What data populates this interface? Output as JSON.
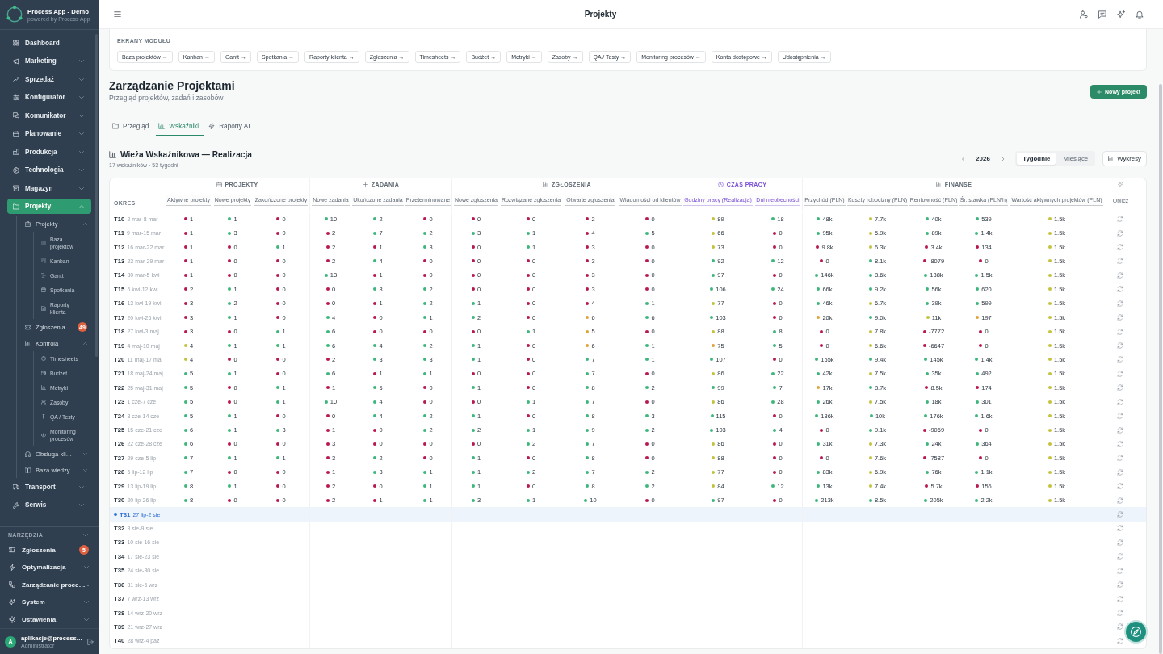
{
  "sidebar": {
    "app_name": "Process App - Demo",
    "app_tagline": "powered by Process App",
    "items": [
      {
        "label": "Dashboard",
        "selected": false
      },
      {
        "label": "Marketing",
        "selected": false,
        "expanded": false
      },
      {
        "label": "Sprzedaż",
        "selected": false,
        "expanded": false
      },
      {
        "label": "Konfigurator",
        "selected": false,
        "expanded": false
      },
      {
        "label": "Komunikator",
        "selected": false,
        "expanded": false
      },
      {
        "label": "Planowanie",
        "selected": false,
        "expanded": false
      },
      {
        "label": "Produkcja",
        "selected": false,
        "expanded": false
      },
      {
        "label": "Technologia",
        "selected": false,
        "expanded": false
      },
      {
        "label": "Magazyn",
        "selected": false,
        "expanded": false
      },
      {
        "label": "Projekty",
        "selected": true,
        "expanded": true,
        "children": [
          {
            "label": "Projekty",
            "selected": false,
            "expanded": true,
            "children": [
              {
                "label": "Baza projektów",
                "selected": false
              },
              {
                "label": "Kanban",
                "selected": false
              },
              {
                "label": "Gantt",
                "selected": false
              },
              {
                "label": "Spotkania",
                "selected": false
              },
              {
                "label": "Raporty klienta",
                "selected": false
              }
            ]
          },
          {
            "label": "Zgłoszenia",
            "selected": false,
            "badge": "49"
          },
          {
            "label": "Kontrola",
            "selected": false,
            "expanded": true,
            "children": [
              {
                "label": "Timesheets",
                "selected": false
              },
              {
                "label": "Budżet",
                "selected": false
              },
              {
                "label": "Metryki",
                "selected": false
              },
              {
                "label": "Zasoby",
                "selected": false
              },
              {
                "label": "QA / Testy",
                "selected": false
              },
              {
                "label": "Monitoring procesów",
                "selected": false
              }
            ]
          },
          {
            "label": "Obsługa kli…",
            "selected": false,
            "expanded": false
          },
          {
            "label": "Baza wiedzy",
            "selected": false,
            "expanded": false
          }
        ]
      },
      {
        "label": "Transport",
        "selected": false,
        "expanded": false
      },
      {
        "label": "Serwis",
        "selected": false,
        "expanded": false
      }
    ],
    "tools": {
      "title": "NARZĘDZIA",
      "items": [
        {
          "label": "Zgłoszenia",
          "selected": false,
          "badge": "5"
        },
        {
          "label": "Optymalizacja",
          "selected": false,
          "expanded": false
        },
        {
          "label": "Zarządzanie proce…",
          "selected": false,
          "expanded": false
        },
        {
          "label": "System",
          "selected": false,
          "expanded": false
        },
        {
          "label": "Ustawienia",
          "selected": false,
          "expanded": false
        }
      ]
    },
    "user": {
      "initial": "A",
      "name": "aplikacje@process…",
      "role": "Administrator"
    }
  },
  "topbar": {
    "title": "Projekty"
  },
  "module_screens": {
    "title": "EKRANY MODUŁU",
    "links": [
      "Baza projektów →",
      "Kanban →",
      "Gantt →",
      "Spotkania →",
      "Raporty klienta →",
      "Zgłoszenia →",
      "Timesheets →",
      "Budżet →",
      "Metryki →",
      "Zasoby →",
      "QA / Testy →",
      "Monitoring procesów →",
      "Konta dostępowe →",
      "Udostępnienia →"
    ]
  },
  "page": {
    "title": "Zarządzanie Projektami",
    "subtitle": "Przegląd projektów, zadań i zasobów",
    "new_button": "Nowy projekt"
  },
  "tabs": [
    {
      "label": "Przegląd",
      "selected": false
    },
    {
      "label": "Wskaźniki",
      "selected": true
    },
    {
      "label": "Raporty AI",
      "selected": false
    }
  ],
  "indicator_tower": {
    "title": "Wieża Wskaźnikowa — Realizacja",
    "subtitle": "17 wskaźników · 53 tygodni",
    "year": "2026",
    "view_modes": [
      {
        "label": "Tygodnie",
        "selected": true
      },
      {
        "label": "Miesiące",
        "selected": false
      }
    ],
    "charts_button": "Wykresy"
  },
  "table": {
    "period_header": "OKRES",
    "action_header": "Oblicz",
    "groups": [
      {
        "label": "PROJEKTY",
        "color": "#5f6973",
        "columns": [
          "Aktywne projekty",
          "Nowe projekty",
          "Zakończone projekty"
        ]
      },
      {
        "label": "ZADANIA",
        "color": "#5f6973",
        "columns": [
          "Nowe zadania",
          "Ukończone zadania",
          "Przeterminowane"
        ]
      },
      {
        "label": "ZGŁOSZENIA",
        "color": "#5f6973",
        "columns": [
          "Nowe zgłoszenia",
          "Rozwiązane zgłoszenia",
          "Otwarte zgłoszenia",
          "Wiadomości od klientów"
        ]
      },
      {
        "label": "CZAS PRACY",
        "color": "#7b4fd6",
        "columns": [
          "Godziny pracy (Realizacja)",
          "Dni nieobecności"
        ]
      },
      {
        "label": "FINANSE",
        "color": "#5f6973",
        "columns": [
          "Przychód (PLN)",
          "Koszty robocizny (PLN)",
          "Rentowność (PLN)",
          "Śr. stawka (PLN/h)",
          "Wartość aktywnych projektów (PLN)"
        ]
      }
    ],
    "rows": [
      {
        "period": "T10",
        "dates": "2 mar-8 mar",
        "current": false,
        "cells": [
          {
            "value": "1",
            "color": "#b8184e"
          },
          {
            "value": "1",
            "color": "#3bb77b"
          },
          {
            "value": "0",
            "color": "#b8184e"
          },
          {
            "value": "10",
            "color": "#3bb77b"
          },
          {
            "value": "2",
            "color": "#3bb77b"
          },
          {
            "value": "0",
            "color": "#b8184e"
          },
          {
            "value": "0",
            "color": "#b8184e"
          },
          {
            "value": "0",
            "color": "#b8184e"
          },
          {
            "value": "2",
            "color": "#b8184e"
          },
          {
            "value": "0",
            "color": "#b8184e"
          },
          {
            "value": "89",
            "color": "#c4c23b"
          },
          {
            "value": "18",
            "color": "#3bb77b"
          },
          {
            "value": "48k",
            "color": "#3bb77b"
          },
          {
            "value": "7.7k",
            "color": "#c4c23b"
          },
          {
            "value": "40k",
            "color": "#3bb77b"
          },
          {
            "value": "539",
            "color": "#3bb77b"
          },
          {
            "value": "1.5k",
            "color": "#c4c23b"
          }
        ]
      },
      {
        "period": "T11",
        "dates": "9 mar-15 mar",
        "current": false,
        "cells": [
          {
            "value": "1",
            "color": "#b8184e"
          },
          {
            "value": "3",
            "color": "#3bb77b"
          },
          {
            "value": "0",
            "color": "#b8184e"
          },
          {
            "value": "2",
            "color": "#b8184e"
          },
          {
            "value": "7",
            "color": "#3bb77b"
          },
          {
            "value": "2",
            "color": "#3bb77b"
          },
          {
            "value": "3",
            "color": "#3bb77b"
          },
          {
            "value": "1",
            "color": "#3bb77b"
          },
          {
            "value": "4",
            "color": "#b8184e"
          },
          {
            "value": "5",
            "color": "#3bb77b"
          },
          {
            "value": "66",
            "color": "#c4c23b"
          },
          {
            "value": "0",
            "color": "#b8184e"
          },
          {
            "value": "95k",
            "color": "#3bb77b"
          },
          {
            "value": "5.9k",
            "color": "#c4c23b"
          },
          {
            "value": "89k",
            "color": "#3bb77b"
          },
          {
            "value": "1.4k",
            "color": "#3bb77b"
          },
          {
            "value": "1.5k",
            "color": "#c4c23b"
          }
        ]
      },
      {
        "period": "T12",
        "dates": "16 mar-22 mar",
        "current": false,
        "cells": [
          {
            "value": "1",
            "color": "#b8184e"
          },
          {
            "value": "0",
            "color": "#b8184e"
          },
          {
            "value": "1",
            "color": "#3bb77b"
          },
          {
            "value": "2",
            "color": "#b8184e"
          },
          {
            "value": "1",
            "color": "#b8184e"
          },
          {
            "value": "3",
            "color": "#3bb77b"
          },
          {
            "value": "0",
            "color": "#b8184e"
          },
          {
            "value": "1",
            "color": "#3bb77b"
          },
          {
            "value": "3",
            "color": "#b8184e"
          },
          {
            "value": "0",
            "color": "#b8184e"
          },
          {
            "value": "73",
            "color": "#c4c23b"
          },
          {
            "value": "0",
            "color": "#b8184e"
          },
          {
            "value": "9.8k",
            "color": "#b8184e"
          },
          {
            "value": "6.3k",
            "color": "#c4c23b"
          },
          {
            "value": "3.4k",
            "color": "#b8184e"
          },
          {
            "value": "134",
            "color": "#b8184e"
          },
          {
            "value": "1.5k",
            "color": "#c4c23b"
          }
        ]
      },
      {
        "period": "T13",
        "dates": "23 mar-29 mar",
        "current": false,
        "cells": [
          {
            "value": "1",
            "color": "#b8184e"
          },
          {
            "value": "0",
            "color": "#b8184e"
          },
          {
            "value": "0",
            "color": "#b8184e"
          },
          {
            "value": "2",
            "color": "#b8184e"
          },
          {
            "value": "4",
            "color": "#3bb77b"
          },
          {
            "value": "0",
            "color": "#b8184e"
          },
          {
            "value": "0",
            "color": "#b8184e"
          },
          {
            "value": "0",
            "color": "#b8184e"
          },
          {
            "value": "3",
            "color": "#b8184e"
          },
          {
            "value": "0",
            "color": "#b8184e"
          },
          {
            "value": "92",
            "color": "#3bb77b"
          },
          {
            "value": "12",
            "color": "#3bb77b"
          },
          {
            "value": "0",
            "color": "#b8184e"
          },
          {
            "value": "8.1k",
            "color": "#3bb77b"
          },
          {
            "value": "-8079",
            "color": "#b8184e"
          },
          {
            "value": "0",
            "color": "#b8184e"
          },
          {
            "value": "1.5k",
            "color": "#c4c23b"
          }
        ]
      },
      {
        "period": "T14",
        "dates": "30 mar-5 kwi",
        "current": false,
        "cells": [
          {
            "value": "1",
            "color": "#b8184e"
          },
          {
            "value": "0",
            "color": "#b8184e"
          },
          {
            "value": "0",
            "color": "#b8184e"
          },
          {
            "value": "13",
            "color": "#3bb77b"
          },
          {
            "value": "1",
            "color": "#b8184e"
          },
          {
            "value": "0",
            "color": "#b8184e"
          },
          {
            "value": "0",
            "color": "#b8184e"
          },
          {
            "value": "0",
            "color": "#b8184e"
          },
          {
            "value": "3",
            "color": "#b8184e"
          },
          {
            "value": "0",
            "color": "#b8184e"
          },
          {
            "value": "97",
            "color": "#3bb77b"
          },
          {
            "value": "0",
            "color": "#b8184e"
          },
          {
            "value": "146k",
            "color": "#3bb77b"
          },
          {
            "value": "8.6k",
            "color": "#3bb77b"
          },
          {
            "value": "138k",
            "color": "#3bb77b"
          },
          {
            "value": "1.5k",
            "color": "#3bb77b"
          },
          {
            "value": "1.5k",
            "color": "#c4c23b"
          }
        ]
      },
      {
        "period": "T15",
        "dates": "6 kwi-12 kwi",
        "current": false,
        "cells": [
          {
            "value": "2",
            "color": "#b8184e"
          },
          {
            "value": "1",
            "color": "#3bb77b"
          },
          {
            "value": "0",
            "color": "#b8184e"
          },
          {
            "value": "0",
            "color": "#b8184e"
          },
          {
            "value": "8",
            "color": "#3bb77b"
          },
          {
            "value": "2",
            "color": "#3bb77b"
          },
          {
            "value": "0",
            "color": "#b8184e"
          },
          {
            "value": "0",
            "color": "#b8184e"
          },
          {
            "value": "3",
            "color": "#b8184e"
          },
          {
            "value": "0",
            "color": "#b8184e"
          },
          {
            "value": "106",
            "color": "#3bb77b"
          },
          {
            "value": "24",
            "color": "#3bb77b"
          },
          {
            "value": "66k",
            "color": "#3bb77b"
          },
          {
            "value": "9.2k",
            "color": "#3bb77b"
          },
          {
            "value": "56k",
            "color": "#3bb77b"
          },
          {
            "value": "620",
            "color": "#3bb77b"
          },
          {
            "value": "1.5k",
            "color": "#c4c23b"
          }
        ]
      },
      {
        "period": "T16",
        "dates": "13 kwi-19 kwi",
        "current": false,
        "cells": [
          {
            "value": "3",
            "color": "#b8184e"
          },
          {
            "value": "2",
            "color": "#3bb77b"
          },
          {
            "value": "0",
            "color": "#b8184e"
          },
          {
            "value": "0",
            "color": "#b8184e"
          },
          {
            "value": "1",
            "color": "#b8184e"
          },
          {
            "value": "2",
            "color": "#3bb77b"
          },
          {
            "value": "1",
            "color": "#3bb77b"
          },
          {
            "value": "0",
            "color": "#b8184e"
          },
          {
            "value": "4",
            "color": "#b8184e"
          },
          {
            "value": "1",
            "color": "#3bb77b"
          },
          {
            "value": "77",
            "color": "#c4c23b"
          },
          {
            "value": "0",
            "color": "#b8184e"
          },
          {
            "value": "46k",
            "color": "#3bb77b"
          },
          {
            "value": "6.7k",
            "color": "#c4c23b"
          },
          {
            "value": "39k",
            "color": "#3bb77b"
          },
          {
            "value": "599",
            "color": "#3bb77b"
          },
          {
            "value": "1.5k",
            "color": "#c4c23b"
          }
        ]
      },
      {
        "period": "T17",
        "dates": "20 kwi-26 kwi",
        "current": false,
        "cells": [
          {
            "value": "3",
            "color": "#b8184e"
          },
          {
            "value": "1",
            "color": "#3bb77b"
          },
          {
            "value": "0",
            "color": "#b8184e"
          },
          {
            "value": "4",
            "color": "#3bb77b"
          },
          {
            "value": "0",
            "color": "#b8184e"
          },
          {
            "value": "1",
            "color": "#3bb77b"
          },
          {
            "value": "2",
            "color": "#3bb77b"
          },
          {
            "value": "0",
            "color": "#b8184e"
          },
          {
            "value": "6",
            "color": "#e2a23b"
          },
          {
            "value": "6",
            "color": "#3bb77b"
          },
          {
            "value": "103",
            "color": "#3bb77b"
          },
          {
            "value": "0",
            "color": "#b8184e"
          },
          {
            "value": "20k",
            "color": "#e2a23b"
          },
          {
            "value": "9.0k",
            "color": "#3bb77b"
          },
          {
            "value": "11k",
            "color": "#c4c23b"
          },
          {
            "value": "197",
            "color": "#e2a23b"
          },
          {
            "value": "1.5k",
            "color": "#c4c23b"
          }
        ]
      },
      {
        "period": "T18",
        "dates": "27 kwi-3 maj",
        "current": false,
        "cells": [
          {
            "value": "3",
            "color": "#b8184e"
          },
          {
            "value": "0",
            "color": "#b8184e"
          },
          {
            "value": "1",
            "color": "#3bb77b"
          },
          {
            "value": "6",
            "color": "#3bb77b"
          },
          {
            "value": "0",
            "color": "#b8184e"
          },
          {
            "value": "0",
            "color": "#b8184e"
          },
          {
            "value": "0",
            "color": "#b8184e"
          },
          {
            "value": "1",
            "color": "#3bb77b"
          },
          {
            "value": "5",
            "color": "#e2a23b"
          },
          {
            "value": "0",
            "color": "#b8184e"
          },
          {
            "value": "88",
            "color": "#c4c23b"
          },
          {
            "value": "8",
            "color": "#3bb77b"
          },
          {
            "value": "0",
            "color": "#b8184e"
          },
          {
            "value": "7.8k",
            "color": "#c4c23b"
          },
          {
            "value": "-7772",
            "color": "#b8184e"
          },
          {
            "value": "0",
            "color": "#b8184e"
          },
          {
            "value": "1.5k",
            "color": "#c4c23b"
          }
        ]
      },
      {
        "period": "T19",
        "dates": "4 maj-10 maj",
        "current": false,
        "cells": [
          {
            "value": "4",
            "color": "#c4c23b"
          },
          {
            "value": "1",
            "color": "#3bb77b"
          },
          {
            "value": "1",
            "color": "#3bb77b"
          },
          {
            "value": "6",
            "color": "#3bb77b"
          },
          {
            "value": "4",
            "color": "#3bb77b"
          },
          {
            "value": "2",
            "color": "#3bb77b"
          },
          {
            "value": "1",
            "color": "#3bb77b"
          },
          {
            "value": "0",
            "color": "#b8184e"
          },
          {
            "value": "6",
            "color": "#e2a23b"
          },
          {
            "value": "1",
            "color": "#3bb77b"
          },
          {
            "value": "75",
            "color": "#e2a23b"
          },
          {
            "value": "5",
            "color": "#3bb77b"
          },
          {
            "value": "0",
            "color": "#b8184e"
          },
          {
            "value": "6.6k",
            "color": "#c4c23b"
          },
          {
            "value": "-6647",
            "color": "#b8184e"
          },
          {
            "value": "0",
            "color": "#b8184e"
          },
          {
            "value": "1.5k",
            "color": "#c4c23b"
          }
        ]
      },
      {
        "period": "T20",
        "dates": "11 maj-17 maj",
        "current": false,
        "cells": [
          {
            "value": "4",
            "color": "#c4c23b"
          },
          {
            "value": "0",
            "color": "#b8184e"
          },
          {
            "value": "0",
            "color": "#b8184e"
          },
          {
            "value": "2",
            "color": "#b8184e"
          },
          {
            "value": "3",
            "color": "#3bb77b"
          },
          {
            "value": "3",
            "color": "#3bb77b"
          },
          {
            "value": "1",
            "color": "#3bb77b"
          },
          {
            "value": "0",
            "color": "#b8184e"
          },
          {
            "value": "7",
            "color": "#3bb77b"
          },
          {
            "value": "1",
            "color": "#3bb77b"
          },
          {
            "value": "107",
            "color": "#3bb77b"
          },
          {
            "value": "0",
            "color": "#b8184e"
          },
          {
            "value": "155k",
            "color": "#3bb77b"
          },
          {
            "value": "9.4k",
            "color": "#3bb77b"
          },
          {
            "value": "145k",
            "color": "#3bb77b"
          },
          {
            "value": "1.4k",
            "color": "#3bb77b"
          },
          {
            "value": "1.5k",
            "color": "#c4c23b"
          }
        ]
      },
      {
        "period": "T21",
        "dates": "18 maj-24 maj",
        "current": false,
        "cells": [
          {
            "value": "5",
            "color": "#3bb77b"
          },
          {
            "value": "1",
            "color": "#3bb77b"
          },
          {
            "value": "0",
            "color": "#b8184e"
          },
          {
            "value": "6",
            "color": "#3bb77b"
          },
          {
            "value": "1",
            "color": "#b8184e"
          },
          {
            "value": "1",
            "color": "#3bb77b"
          },
          {
            "value": "0",
            "color": "#b8184e"
          },
          {
            "value": "0",
            "color": "#b8184e"
          },
          {
            "value": "7",
            "color": "#3bb77b"
          },
          {
            "value": "0",
            "color": "#b8184e"
          },
          {
            "value": "86",
            "color": "#c4c23b"
          },
          {
            "value": "22",
            "color": "#3bb77b"
          },
          {
            "value": "42k",
            "color": "#3bb77b"
          },
          {
            "value": "7.5k",
            "color": "#c4c23b"
          },
          {
            "value": "35k",
            "color": "#3bb77b"
          },
          {
            "value": "492",
            "color": "#3bb77b"
          },
          {
            "value": "1.5k",
            "color": "#c4c23b"
          }
        ]
      },
      {
        "period": "T22",
        "dates": "25 maj-31 maj",
        "current": false,
        "cells": [
          {
            "value": "5",
            "color": "#3bb77b"
          },
          {
            "value": "0",
            "color": "#b8184e"
          },
          {
            "value": "1",
            "color": "#3bb77b"
          },
          {
            "value": "1",
            "color": "#b8184e"
          },
          {
            "value": "5",
            "color": "#3bb77b"
          },
          {
            "value": "0",
            "color": "#b8184e"
          },
          {
            "value": "1",
            "color": "#3bb77b"
          },
          {
            "value": "0",
            "color": "#b8184e"
          },
          {
            "value": "8",
            "color": "#3bb77b"
          },
          {
            "value": "2",
            "color": "#3bb77b"
          },
          {
            "value": "99",
            "color": "#3bb77b"
          },
          {
            "value": "7",
            "color": "#3bb77b"
          },
          {
            "value": "17k",
            "color": "#e2a23b"
          },
          {
            "value": "8.7k",
            "color": "#3bb77b"
          },
          {
            "value": "8.5k",
            "color": "#b8184e"
          },
          {
            "value": "174",
            "color": "#b8184e"
          },
          {
            "value": "1.5k",
            "color": "#c4c23b"
          }
        ]
      },
      {
        "period": "T23",
        "dates": "1 cze-7 cze",
        "current": false,
        "cells": [
          {
            "value": "5",
            "color": "#3bb77b"
          },
          {
            "value": "0",
            "color": "#b8184e"
          },
          {
            "value": "1",
            "color": "#3bb77b"
          },
          {
            "value": "10",
            "color": "#3bb77b"
          },
          {
            "value": "4",
            "color": "#3bb77b"
          },
          {
            "value": "0",
            "color": "#b8184e"
          },
          {
            "value": "0",
            "color": "#b8184e"
          },
          {
            "value": "1",
            "color": "#3bb77b"
          },
          {
            "value": "7",
            "color": "#3bb77b"
          },
          {
            "value": "0",
            "color": "#b8184e"
          },
          {
            "value": "86",
            "color": "#c4c23b"
          },
          {
            "value": "28",
            "color": "#3bb77b"
          },
          {
            "value": "26k",
            "color": "#3bb77b"
          },
          {
            "value": "7.5k",
            "color": "#c4c23b"
          },
          {
            "value": "18k",
            "color": "#3bb77b"
          },
          {
            "value": "301",
            "color": "#3bb77b"
          },
          {
            "value": "1.5k",
            "color": "#c4c23b"
          }
        ]
      },
      {
        "period": "T24",
        "dates": "8 cze-14 cze",
        "current": false,
        "cells": [
          {
            "value": "5",
            "color": "#3bb77b"
          },
          {
            "value": "1",
            "color": "#3bb77b"
          },
          {
            "value": "0",
            "color": "#b8184e"
          },
          {
            "value": "0",
            "color": "#b8184e"
          },
          {
            "value": "4",
            "color": "#3bb77b"
          },
          {
            "value": "2",
            "color": "#3bb77b"
          },
          {
            "value": "1",
            "color": "#3bb77b"
          },
          {
            "value": "0",
            "color": "#b8184e"
          },
          {
            "value": "8",
            "color": "#3bb77b"
          },
          {
            "value": "3",
            "color": "#3bb77b"
          },
          {
            "value": "115",
            "color": "#3bb77b"
          },
          {
            "value": "0",
            "color": "#b8184e"
          },
          {
            "value": "186k",
            "color": "#3bb77b"
          },
          {
            "value": "10k",
            "color": "#3bb77b"
          },
          {
            "value": "176k",
            "color": "#3bb77b"
          },
          {
            "value": "1.6k",
            "color": "#3bb77b"
          },
          {
            "value": "1.5k",
            "color": "#c4c23b"
          }
        ]
      },
      {
        "period": "T25",
        "dates": "15 cze-21 cze",
        "current": false,
        "cells": [
          {
            "value": "6",
            "color": "#3bb77b"
          },
          {
            "value": "1",
            "color": "#3bb77b"
          },
          {
            "value": "3",
            "color": "#3bb77b"
          },
          {
            "value": "1",
            "color": "#b8184e"
          },
          {
            "value": "0",
            "color": "#b8184e"
          },
          {
            "value": "2",
            "color": "#3bb77b"
          },
          {
            "value": "2",
            "color": "#3bb77b"
          },
          {
            "value": "1",
            "color": "#3bb77b"
          },
          {
            "value": "9",
            "color": "#3bb77b"
          },
          {
            "value": "2",
            "color": "#3bb77b"
          },
          {
            "value": "103",
            "color": "#3bb77b"
          },
          {
            "value": "4",
            "color": "#3bb77b"
          },
          {
            "value": "0",
            "color": "#b8184e"
          },
          {
            "value": "9.1k",
            "color": "#3bb77b"
          },
          {
            "value": "-9069",
            "color": "#b8184e"
          },
          {
            "value": "0",
            "color": "#b8184e"
          },
          {
            "value": "1.5k",
            "color": "#c4c23b"
          }
        ]
      },
      {
        "period": "T26",
        "dates": "22 cze-28 cze",
        "current": false,
        "cells": [
          {
            "value": "6",
            "color": "#3bb77b"
          },
          {
            "value": "0",
            "color": "#b8184e"
          },
          {
            "value": "0",
            "color": "#b8184e"
          },
          {
            "value": "3",
            "color": "#b8184e"
          },
          {
            "value": "0",
            "color": "#b8184e"
          },
          {
            "value": "0",
            "color": "#b8184e"
          },
          {
            "value": "0",
            "color": "#b8184e"
          },
          {
            "value": "2",
            "color": "#3bb77b"
          },
          {
            "value": "7",
            "color": "#3bb77b"
          },
          {
            "value": "0",
            "color": "#b8184e"
          },
          {
            "value": "86",
            "color": "#c4c23b"
          },
          {
            "value": "0",
            "color": "#b8184e"
          },
          {
            "value": "31k",
            "color": "#3bb77b"
          },
          {
            "value": "7.3k",
            "color": "#c4c23b"
          },
          {
            "value": "24k",
            "color": "#3bb77b"
          },
          {
            "value": "364",
            "color": "#3bb77b"
          },
          {
            "value": "1.5k",
            "color": "#c4c23b"
          }
        ]
      },
      {
        "period": "T27",
        "dates": "29 cze-5 lip",
        "current": false,
        "cells": [
          {
            "value": "7",
            "color": "#3bb77b"
          },
          {
            "value": "1",
            "color": "#3bb77b"
          },
          {
            "value": "1",
            "color": "#3bb77b"
          },
          {
            "value": "3",
            "color": "#b8184e"
          },
          {
            "value": "2",
            "color": "#3bb77b"
          },
          {
            "value": "0",
            "color": "#b8184e"
          },
          {
            "value": "1",
            "color": "#3bb77b"
          },
          {
            "value": "0",
            "color": "#b8184e"
          },
          {
            "value": "8",
            "color": "#3bb77b"
          },
          {
            "value": "0",
            "color": "#b8184e"
          },
          {
            "value": "88",
            "color": "#c4c23b"
          },
          {
            "value": "0",
            "color": "#b8184e"
          },
          {
            "value": "0",
            "color": "#b8184e"
          },
          {
            "value": "7.6k",
            "color": "#c4c23b"
          },
          {
            "value": "-7587",
            "color": "#b8184e"
          },
          {
            "value": "0",
            "color": "#b8184e"
          },
          {
            "value": "1.5k",
            "color": "#c4c23b"
          }
        ]
      },
      {
        "period": "T28",
        "dates": "6 lip-12 lip",
        "current": false,
        "cells": [
          {
            "value": "7",
            "color": "#3bb77b"
          },
          {
            "value": "0",
            "color": "#b8184e"
          },
          {
            "value": "0",
            "color": "#b8184e"
          },
          {
            "value": "1",
            "color": "#b8184e"
          },
          {
            "value": "3",
            "color": "#3bb77b"
          },
          {
            "value": "1",
            "color": "#3bb77b"
          },
          {
            "value": "1",
            "color": "#3bb77b"
          },
          {
            "value": "2",
            "color": "#3bb77b"
          },
          {
            "value": "7",
            "color": "#3bb77b"
          },
          {
            "value": "2",
            "color": "#3bb77b"
          },
          {
            "value": "77",
            "color": "#c4c23b"
          },
          {
            "value": "0",
            "color": "#b8184e"
          },
          {
            "value": "83k",
            "color": "#3bb77b"
          },
          {
            "value": "6.9k",
            "color": "#c4c23b"
          },
          {
            "value": "76k",
            "color": "#3bb77b"
          },
          {
            "value": "1.1k",
            "color": "#3bb77b"
          },
          {
            "value": "1.5k",
            "color": "#c4c23b"
          }
        ]
      },
      {
        "period": "T29",
        "dates": "13 lip-19 lip",
        "current": false,
        "cells": [
          {
            "value": "8",
            "color": "#3bb77b"
          },
          {
            "value": "1",
            "color": "#3bb77b"
          },
          {
            "value": "0",
            "color": "#b8184e"
          },
          {
            "value": "2",
            "color": "#b8184e"
          },
          {
            "value": "0",
            "color": "#b8184e"
          },
          {
            "value": "1",
            "color": "#3bb77b"
          },
          {
            "value": "1",
            "color": "#3bb77b"
          },
          {
            "value": "0",
            "color": "#b8184e"
          },
          {
            "value": "8",
            "color": "#3bb77b"
          },
          {
            "value": "2",
            "color": "#3bb77b"
          },
          {
            "value": "84",
            "color": "#c4c23b"
          },
          {
            "value": "12",
            "color": "#3bb77b"
          },
          {
            "value": "13k",
            "color": "#3bb77b"
          },
          {
            "value": "7.4k",
            "color": "#c4c23b"
          },
          {
            "value": "5.7k",
            "color": "#b8184e"
          },
          {
            "value": "156",
            "color": "#b8184e"
          },
          {
            "value": "1.5k",
            "color": "#c4c23b"
          }
        ]
      },
      {
        "period": "T30",
        "dates": "20 lip-26 lip",
        "current": false,
        "cells": [
          {
            "value": "8",
            "color": "#3bb77b"
          },
          {
            "value": "0",
            "color": "#b8184e"
          },
          {
            "value": "0",
            "color": "#b8184e"
          },
          {
            "value": "2",
            "color": "#b8184e"
          },
          {
            "value": "1",
            "color": "#b8184e"
          },
          {
            "value": "1",
            "color": "#3bb77b"
          },
          {
            "value": "3",
            "color": "#3bb77b"
          },
          {
            "value": "1",
            "color": "#3bb77b"
          },
          {
            "value": "10",
            "color": "#3bb77b"
          },
          {
            "value": "0",
            "color": "#b8184e"
          },
          {
            "value": "97",
            "color": "#3bb77b"
          },
          {
            "value": "0",
            "color": "#b8184e"
          },
          {
            "value": "213k",
            "color": "#3bb77b"
          },
          {
            "value": "8.5k",
            "color": "#3bb77b"
          },
          {
            "value": "205k",
            "color": "#3bb77b"
          },
          {
            "value": "2.2k",
            "color": "#3bb77b"
          },
          {
            "value": "1.5k",
            "color": "#c4c23b"
          }
        ]
      },
      {
        "period": "T31",
        "dates": "27 lip-2 sie",
        "current": true
      },
      {
        "period": "T32",
        "dates": "3 sie-9 sie",
        "current": false
      },
      {
        "period": "T33",
        "dates": "10 sie-16 sie",
        "current": false
      },
      {
        "period": "T34",
        "dates": "17 sie-23 sie",
        "current": false
      },
      {
        "period": "T35",
        "dates": "24 sie-30 sie",
        "current": false
      },
      {
        "period": "T36",
        "dates": "31 sie-6 wrz",
        "current": false
      },
      {
        "period": "T37",
        "dates": "7 wrz-13 wrz",
        "current": false
      },
      {
        "period": "T38",
        "dates": "14 wrz-20 wrz",
        "current": false
      },
      {
        "period": "T39",
        "dates": "21 wrz-27 wrz",
        "current": false
      },
      {
        "period": "T40",
        "dates": "28 wrz-4 paź",
        "current": false
      }
    ]
  }
}
